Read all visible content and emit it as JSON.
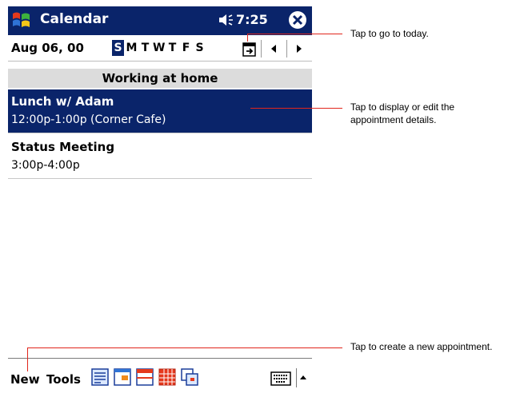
{
  "titlebar": {
    "title": "Calendar",
    "time": "7:25"
  },
  "navbar": {
    "date": "Aug 06, 00",
    "days": [
      "S",
      "M",
      "T",
      "W",
      "T",
      "F",
      "S"
    ],
    "selected_day_index": 0
  },
  "banner": "Working at home",
  "appointments": [
    {
      "title": "Lunch w/ Adam",
      "detail": "12:00p-1:00p (Corner Cafe)"
    },
    {
      "title": "Status Meeting",
      "detail": "3:00p-4:00p"
    }
  ],
  "menubar": {
    "new": "New",
    "tools": "Tools"
  },
  "callouts": {
    "today": "Tap to go to today.",
    "details_line1": "Tap to display or edit the",
    "details_line2": "appointment details.",
    "new_appt": "Tap to create a new appointment."
  },
  "colors": {
    "selection": "#0a246a",
    "callout_line": "#e1261c"
  },
  "icons": [
    "windows-start-icon",
    "speaker-icon",
    "close-icon",
    "go-to-today-icon",
    "left-arrow-icon",
    "right-arrow-icon",
    "agenda-view-icon",
    "day-view-icon",
    "week-view-icon",
    "month-view-icon",
    "year-view-icon",
    "keyboard-icon",
    "up-arrow-icon"
  ]
}
